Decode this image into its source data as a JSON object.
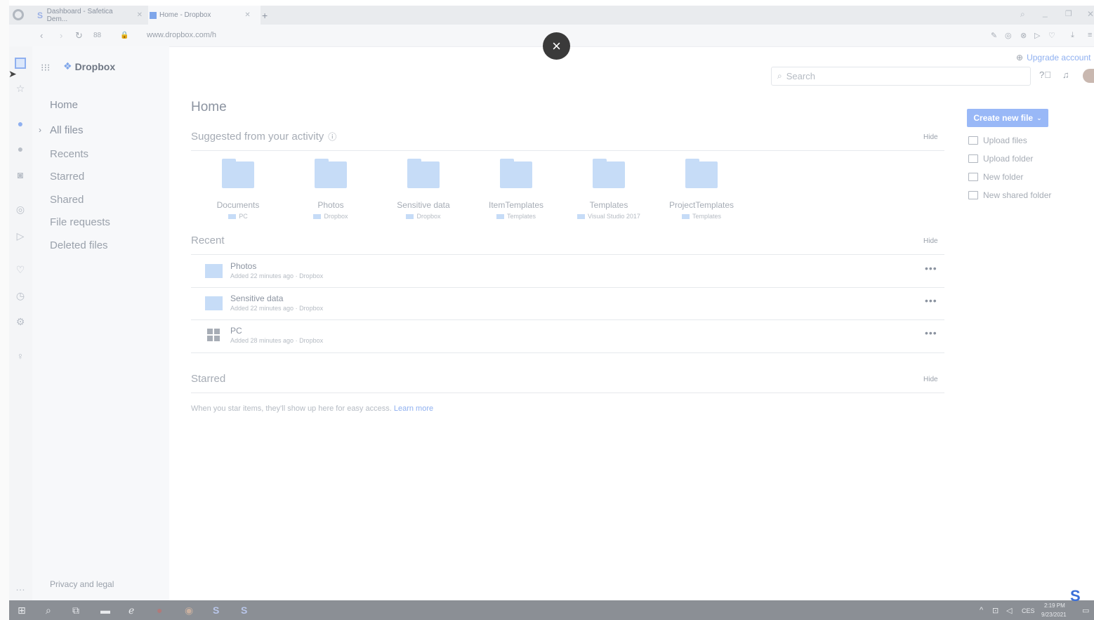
{
  "browser": {
    "tabs": [
      {
        "label": "Dashboard - Safetica Dem..."
      },
      {
        "label": "Home - Dropbox"
      }
    ],
    "tab_add": "+",
    "url": "www.dropbox.com/h"
  },
  "header": {
    "logo_text": "Dropbox",
    "upgrade": "Upgrade account",
    "search_placeholder": "Search"
  },
  "nav": {
    "items": [
      "Home",
      "All files",
      "Recents",
      "Starred",
      "Shared",
      "File requests",
      "Deleted files"
    ],
    "footer": "Privacy and legal"
  },
  "main": {
    "page_title": "Home",
    "suggested": {
      "title": "Suggested from your activity",
      "hide": "Hide",
      "folders": [
        {
          "name": "Documents",
          "location": "PC"
        },
        {
          "name": "Photos",
          "location": "Dropbox"
        },
        {
          "name": "Sensitive data",
          "location": "Dropbox"
        },
        {
          "name": "ItemTemplates",
          "location": "Templates"
        },
        {
          "name": "Templates",
          "location": "Visual Studio 2017"
        },
        {
          "name": "ProjectTemplates",
          "location": "Templates"
        }
      ]
    },
    "recent": {
      "title": "Recent",
      "hide": "Hide",
      "items": [
        {
          "name": "Photos",
          "meta": "Added 22 minutes ago · Dropbox"
        },
        {
          "name": "Sensitive data",
          "meta": "Added 22 minutes ago · Dropbox"
        },
        {
          "name": "PC",
          "meta": "Added 28 minutes ago · Dropbox"
        }
      ],
      "more": "•••"
    },
    "starred": {
      "title": "Starred",
      "hide": "Hide",
      "empty_text": "When you star items, they'll show up here for easy access.",
      "learn_more": "Learn more"
    }
  },
  "actions": {
    "create_new_file": "Create new file",
    "items": [
      "Upload files",
      "Upload folder",
      "New folder",
      "New shared folder"
    ]
  },
  "overlay": {
    "close": "×"
  },
  "taskbar": {
    "lang": "CES",
    "time": "2:19 PM",
    "date": "9/23/2021"
  },
  "colors": {
    "accent": "#99b8f7",
    "folder": "#c6dcf7",
    "link": "#8fb0f0"
  }
}
